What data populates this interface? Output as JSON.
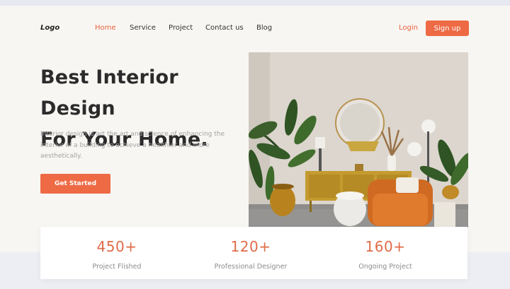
{
  "header": {
    "logo": "Logo",
    "nav": [
      "Home",
      "Service",
      "Project",
      "Contact us",
      "Blog"
    ],
    "login": "Login",
    "signup": "Sign up"
  },
  "hero": {
    "title_line1": "Best Interior Design",
    "title_line2": "For Your Home.",
    "description": "Interior design is art the art and science of enhancing the interior of a building to achieve a healthier and more aesthetically.",
    "cta": "Get Started"
  },
  "stats": [
    {
      "value": "450+",
      "label": "Project Flished"
    },
    {
      "value": "120+",
      "label": "Professional Designer"
    },
    {
      "value": "160+",
      "label": "Ongoing Project"
    }
  ],
  "colors": {
    "accent": "#ee6a45",
    "background": "#f8f6f3",
    "wall": "#dcd6ce"
  }
}
